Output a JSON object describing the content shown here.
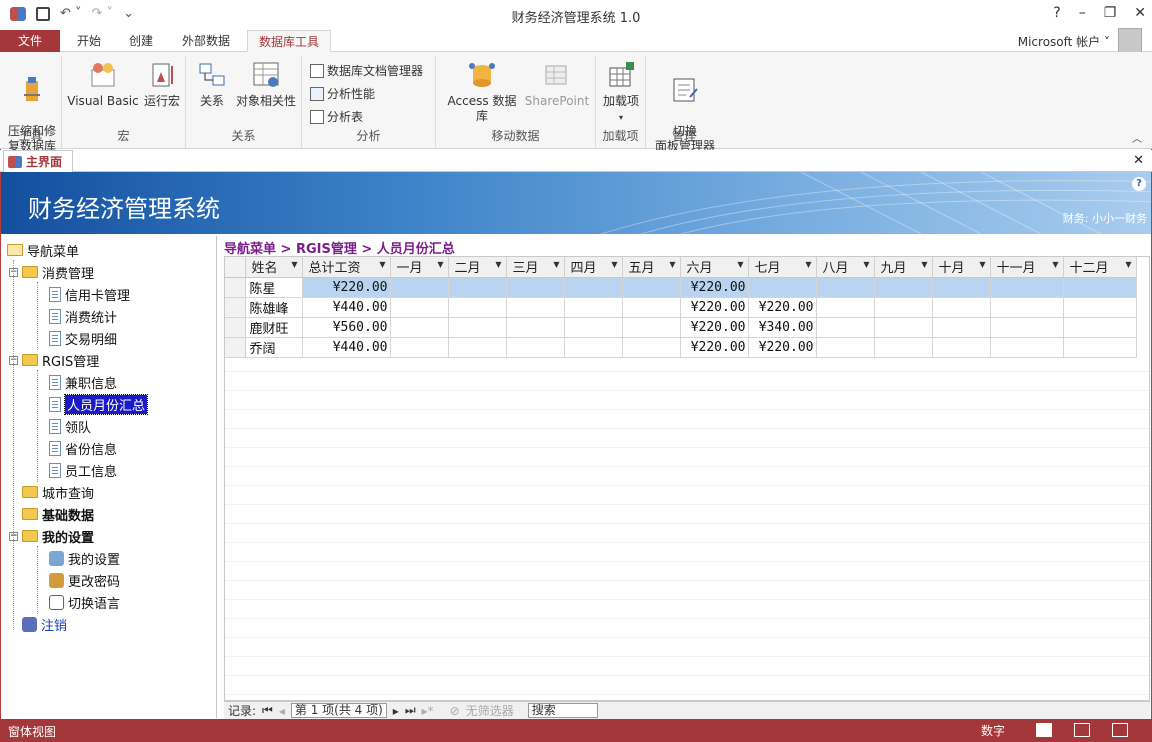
{
  "window": {
    "title": "财务经济管理系统 1.0",
    "controls": {
      "help": "?",
      "minimize": "–",
      "restore": "❐",
      "close": "✕"
    }
  },
  "ribbon_tabs": [
    "文件",
    "开始",
    "创建",
    "外部数据",
    "数据库工具"
  ],
  "active_tab": "数据库工具",
  "account": "Microsoft 帐户",
  "ribbon": {
    "tools": {
      "label": "工具",
      "compact": "压缩和修\n复数据库"
    },
    "macro": {
      "label": "宏",
      "vb": "Visual Basic",
      "run": "运行宏"
    },
    "relations": {
      "label": "关系",
      "rel": "关系",
      "deps": "对象相关性"
    },
    "analyze": {
      "label": "分析",
      "documenter": "数据库文档管理器",
      "perf": "分析性能",
      "table": "分析表"
    },
    "move": {
      "label": "移动数据",
      "access": "Access 数据库",
      "sharepoint": "SharePoint"
    },
    "addins": {
      "label": "加载项",
      "btn": "加载项"
    },
    "manage": {
      "label": "管理",
      "switch": "切换\n面板管理器"
    }
  },
  "doc_tab": "主界面",
  "banner": {
    "title": "财务经济管理系统",
    "user": "财务: 小小一财务"
  },
  "nav": {
    "root": "导航菜单",
    "items": [
      {
        "label": "消费管理",
        "level": 1,
        "type": "folder",
        "expanded": true,
        "bold": false
      },
      {
        "label": "信用卡管理",
        "level": 2,
        "type": "doc"
      },
      {
        "label": "消费统计",
        "level": 2,
        "type": "doc"
      },
      {
        "label": "交易明细",
        "level": 2,
        "type": "doc"
      },
      {
        "label": "RGIS管理",
        "level": 1,
        "type": "folder",
        "expanded": true,
        "bold": false
      },
      {
        "label": "兼职信息",
        "level": 2,
        "type": "doc"
      },
      {
        "label": "人员月份汇总",
        "level": 2,
        "type": "doc",
        "selected": true
      },
      {
        "label": "领队",
        "level": 2,
        "type": "doc"
      },
      {
        "label": "省份信息",
        "level": 2,
        "type": "doc"
      },
      {
        "label": "员工信息",
        "level": 2,
        "type": "doc"
      },
      {
        "label": "城市查询",
        "level": 1,
        "type": "folder"
      },
      {
        "label": "基础数据",
        "level": 1,
        "type": "folder",
        "bold": true
      },
      {
        "label": "我的设置",
        "level": 1,
        "type": "folder",
        "expanded": true,
        "bold": true
      },
      {
        "label": "我的设置",
        "level": 2,
        "type": "settings"
      },
      {
        "label": "更改密码",
        "level": 2,
        "type": "password"
      },
      {
        "label": "切换语言",
        "level": 2,
        "type": "language"
      },
      {
        "label": "注销",
        "level": 1,
        "type": "logout",
        "link": true
      }
    ]
  },
  "breadcrumb": "导航菜单 > RGIS管理 > 人员月份汇总",
  "table": {
    "columns": [
      "姓名",
      "总计工资",
      "一月",
      "二月",
      "三月",
      "四月",
      "五月",
      "六月",
      "七月",
      "八月",
      "九月",
      "十月",
      "十一月",
      "十二月"
    ],
    "rows": [
      [
        "陈星",
        "¥220.00",
        "",
        "",
        "",
        "",
        "",
        "¥220.00",
        "",
        "",
        "",
        "",
        "",
        ""
      ],
      [
        "陈雄峰",
        "¥440.00",
        "",
        "",
        "",
        "",
        "",
        "¥220.00",
        "¥220.00",
        "",
        "",
        "",
        "",
        ""
      ],
      [
        "鹿财旺",
        "¥560.00",
        "",
        "",
        "",
        "",
        "",
        "¥220.00",
        "¥340.00",
        "",
        "",
        "",
        "",
        ""
      ],
      [
        "乔阔",
        "¥440.00",
        "",
        "",
        "",
        "",
        "",
        "¥220.00",
        "¥220.00",
        "",
        "",
        "",
        "",
        ""
      ]
    ],
    "selected_row": 0
  },
  "record_nav": {
    "label": "记录:",
    "position": "第 1 项(共 4 项)",
    "filter": "无筛选器",
    "search": "搜索"
  },
  "status": {
    "left": "窗体视图",
    "mode": "数字"
  }
}
